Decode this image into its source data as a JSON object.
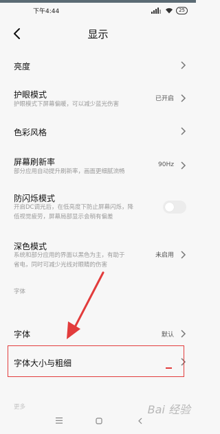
{
  "status": {
    "time": "下午4:44",
    "battery": "25"
  },
  "header": {
    "title": "显示"
  },
  "items": [
    {
      "title": "亮度"
    },
    {
      "title": "护眼模式",
      "subtitle": "护眼模式下屏幕偏暖，可以减少蓝光伤害",
      "value": "已开启"
    },
    {
      "title": "色彩风格"
    },
    {
      "title": "屏幕刷新率",
      "subtitle": "部分应用自动提升刷新率，画面更细腻流畅",
      "value": "90Hz"
    },
    {
      "title": "防闪烁模式",
      "subtitle_line1": "开启DC调光后，在低亮度下防止屏幕闪烁，降",
      "subtitle_line2": "低视觉疲劳，屏幕局部显示会稍有偏差",
      "toggle_on": false
    },
    {
      "title": "深色模式",
      "subtitle_line1": "系统和部分应用的界面以黑色为主，有助于",
      "subtitle_line2": "省电，同时可减少光线对眼睛的伤害",
      "value": "未启用"
    }
  ],
  "font_section": {
    "label": "字体",
    "items": [
      {
        "title": "字体",
        "value": "默认"
      },
      {
        "title": "字体大小与粗细"
      }
    ],
    "next_label": "更多"
  },
  "annotation": {
    "color": "#e23c3c"
  },
  "watermark": "Bai 经验"
}
